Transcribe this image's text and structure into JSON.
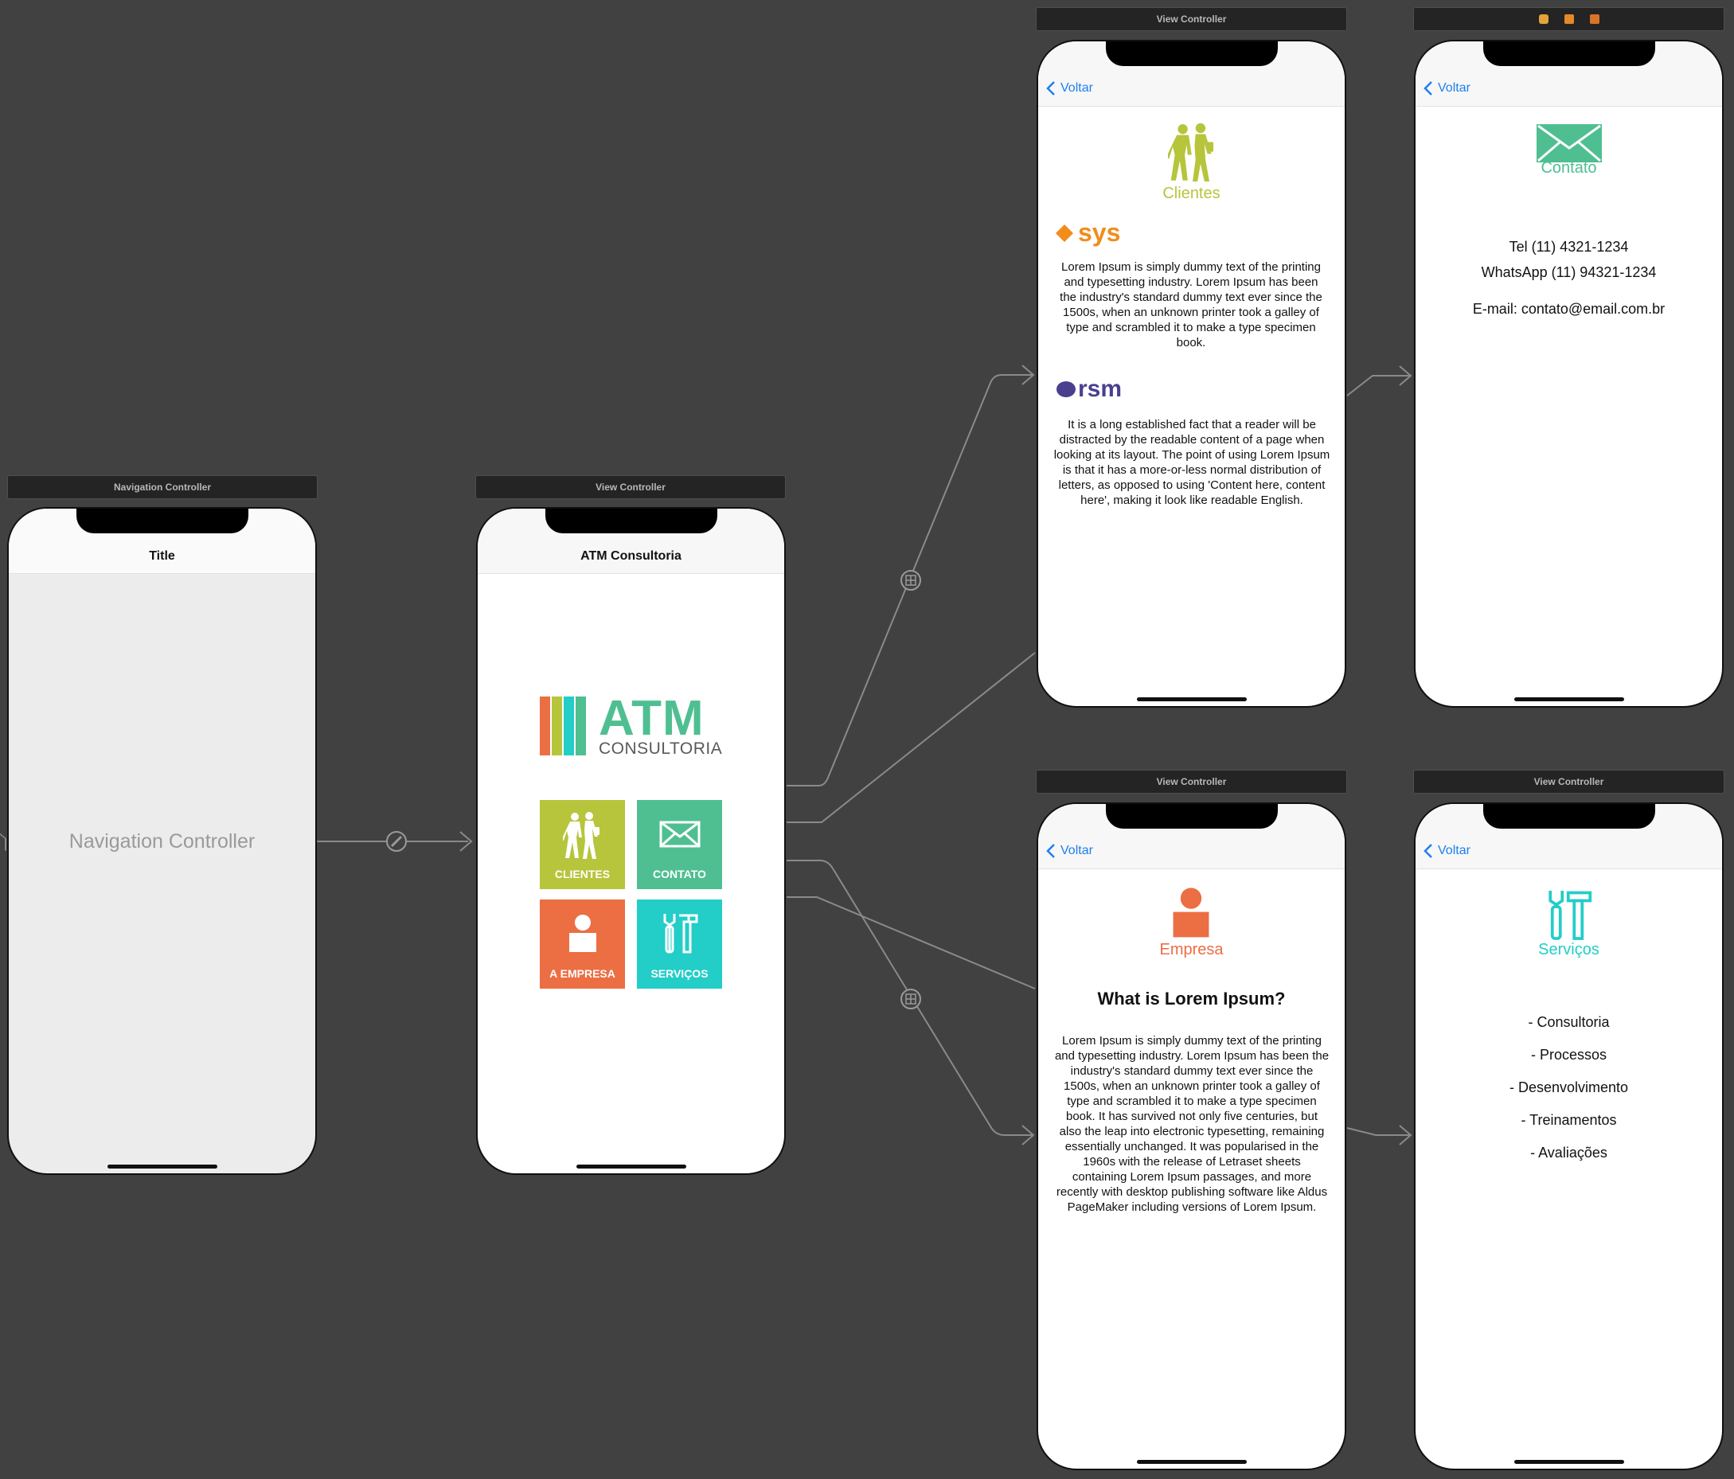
{
  "canvas": {
    "scene_titles": {
      "nav": "Navigation Controller",
      "home": "View Controller",
      "clientes": "View Controller",
      "empresa": "View Controller",
      "servicos": "View Controller"
    }
  },
  "colors": {
    "canvas_bg": "#414141",
    "ios_blue": "#1e7ff0",
    "clientes_green": "#b6c53b",
    "contato_green": "#4fbf92",
    "empresa_orange": "#ec6e43",
    "servicos_teal": "#23cdc8",
    "sys_orange": "#f28c1a",
    "rsm_purple": "#4a3f8f"
  },
  "nav_scene": {
    "nav_title": "Title",
    "placeholder": "Navigation Controller"
  },
  "home": {
    "nav_title": "ATM Consultoria",
    "logo_main": "ATM",
    "logo_sub": "CONSULTORIA",
    "tiles": [
      {
        "label": "CLIENTES",
        "icon": "people-walking-icon"
      },
      {
        "label": "CONTATO",
        "icon": "envelope-icon"
      },
      {
        "label": "A EMPRESA",
        "icon": "person-icon"
      },
      {
        "label": "SERVIÇOS",
        "icon": "tools-icon"
      }
    ]
  },
  "clientes": {
    "back_label": "Voltar",
    "heading": "Clientes",
    "client1_name": "sys",
    "client1_text": "Lorem Ipsum is simply dummy text of the printing and typesetting industry. Lorem Ipsum has been the industry's standard dummy text ever since the 1500s, when an unknown printer took a galley of type and scrambled it to make a type specimen book.",
    "client2_name": "rsm",
    "client2_text": "It is a long established fact that a reader will be distracted by the readable content of a page when looking at its layout. The point of using Lorem Ipsum is that it has a more-or-less normal distribution of letters, as opposed to using 'Content here, content here', making it look like readable English."
  },
  "contato": {
    "back_label": "Voltar",
    "heading": "Contato",
    "tel": "Tel (11) 4321-1234",
    "whatsapp": "WhatsApp (11) 94321-1234",
    "email": "E-mail: contato@email.com.br"
  },
  "empresa": {
    "back_label": "Voltar",
    "heading": "Empresa",
    "subheading": "What is Lorem Ipsum?",
    "body": "Lorem Ipsum is simply dummy text of the printing and typesetting industry. Lorem Ipsum has been the industry's standard dummy text ever since the 1500s, when an unknown printer took a galley of type and scrambled it to make a type specimen book. It has survived not only five centuries, but also the leap into electronic typesetting, remaining essentially unchanged. It was popularised in the 1960s with the release of Letraset sheets containing Lorem Ipsum passages, and more recently with desktop publishing software like Aldus PageMaker including versions of Lorem Ipsum."
  },
  "servicos": {
    "back_label": "Voltar",
    "heading": "Serviços",
    "items": [
      "- Consultoria",
      "- Processos",
      "- Desenvolvimento",
      "- Treinamentos",
      "- Avaliações"
    ]
  }
}
